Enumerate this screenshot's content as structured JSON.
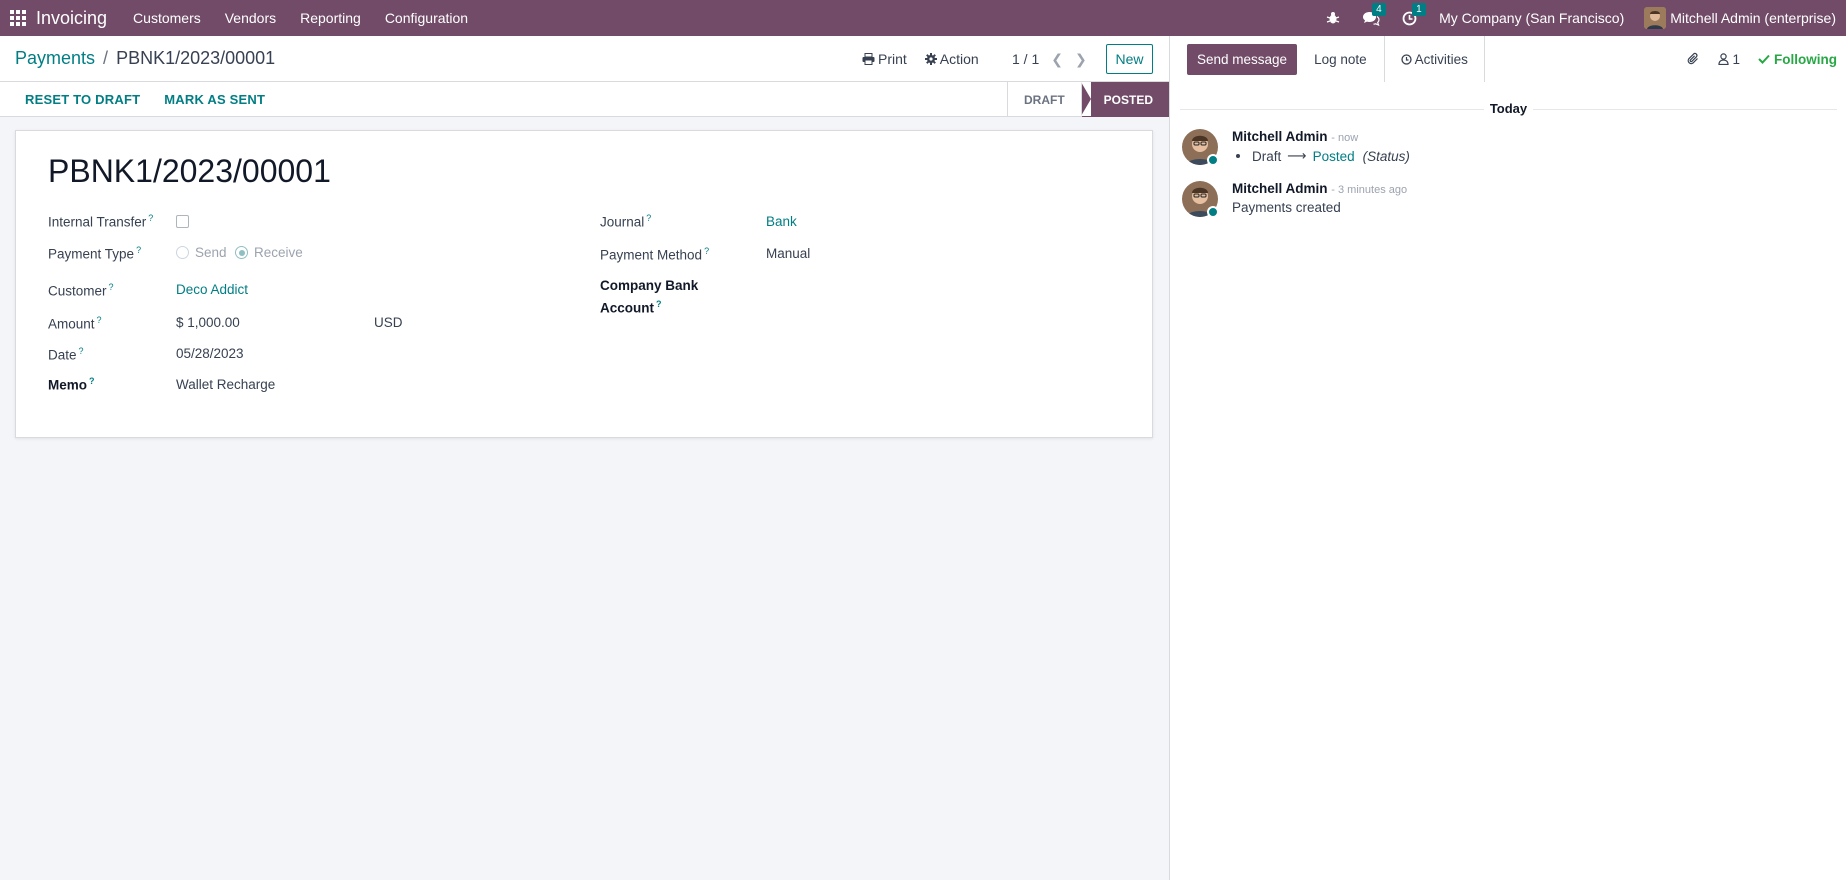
{
  "navbar": {
    "app_name": "Invoicing",
    "menu": [
      "Customers",
      "Vendors",
      "Reporting",
      "Configuration"
    ],
    "messages_count": "4",
    "activities_count": "1",
    "company": "My Company (San Francisco)",
    "user": "Mitchell Admin (enterprise)"
  },
  "breadcrumb": {
    "parent": "Payments",
    "separator": "/",
    "current": "PBNK1/2023/00001"
  },
  "control": {
    "print": "Print",
    "action": "Action",
    "pager": "1 / 1",
    "new": "New"
  },
  "statusbar": {
    "buttons": [
      "RESET TO DRAFT",
      "MARK AS SENT"
    ],
    "stages": [
      "DRAFT",
      "POSTED"
    ],
    "active_stage": "POSTED"
  },
  "form": {
    "title": "PBNK1/2023/00001",
    "internal_transfer_label": "Internal Transfer",
    "internal_transfer_checked": false,
    "payment_type_label": "Payment Type",
    "payment_type_options": [
      "Send",
      "Receive"
    ],
    "payment_type_selected": "Receive",
    "customer_label": "Customer",
    "customer_value": "Deco Addict",
    "amount_label": "Amount",
    "amount_value": "$ 1,000.00",
    "currency": "USD",
    "date_label": "Date",
    "date_value": "05/28/2023",
    "memo_label": "Memo",
    "memo_value": "Wallet Recharge",
    "journal_label": "Journal",
    "journal_value": "Bank",
    "payment_method_label": "Payment Method",
    "payment_method_value": "Manual",
    "company_bank_label_1": "Company Bank",
    "company_bank_label_2": "Account",
    "help_mark": "?"
  },
  "chatter": {
    "send_message": "Send message",
    "log_note": "Log note",
    "activities": "Activities",
    "followers_count": "1",
    "following": "Following",
    "day": "Today",
    "messages": [
      {
        "author": "Mitchell Admin",
        "time": "- now",
        "old_value": "Draft",
        "new_value": "Posted",
        "field": "(Status)"
      },
      {
        "author": "Mitchell Admin",
        "time": "- 3 minutes ago",
        "body": "Payments created"
      }
    ]
  },
  "colors": {
    "brand": "#714b67",
    "accent": "#017e84",
    "following": "#28a745"
  }
}
